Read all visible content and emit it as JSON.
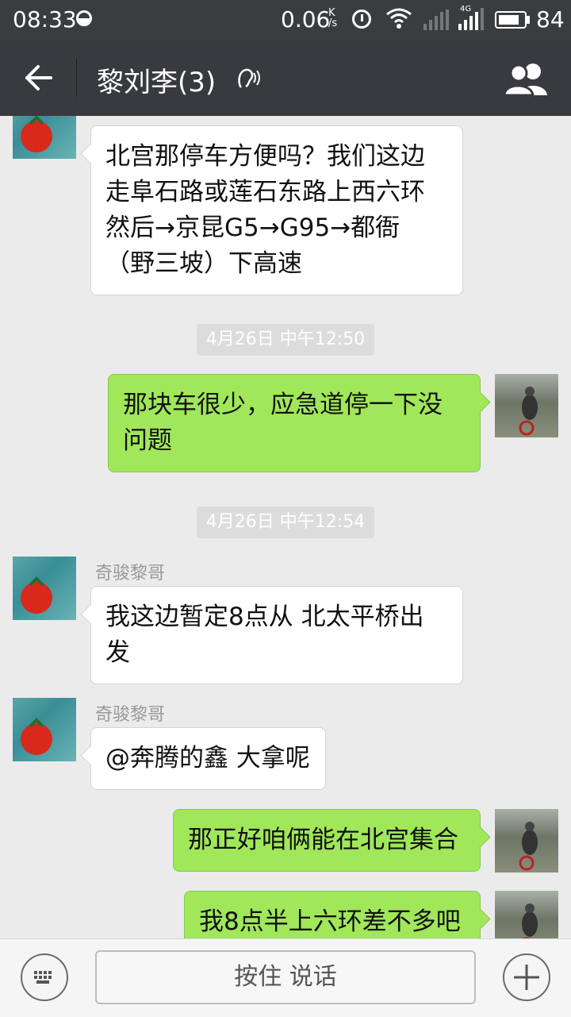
{
  "status_bar": {
    "time": "08:33",
    "net_speed": "0.06",
    "net_speed_unit_top": "K",
    "net_speed_unit_bottom": "/s",
    "network_type": "4G",
    "battery": "84",
    "battery_fraction": 0.84
  },
  "header": {
    "title": "黎刘李(3)",
    "back_icon": "arrow-left-icon",
    "earpiece_icon": "earpiece-mode-icon",
    "group_icon": "group-members-icon"
  },
  "messages": [
    {
      "side": "left",
      "sender": "",
      "text": "北宫那停车方便吗？我们这边走阜石路或莲石东路上西六环然后→京昆G5→G95→都衙（野三坡）下高速"
    },
    {
      "type": "timestamp",
      "text": "4月26日 中午12:50"
    },
    {
      "side": "right",
      "text": "那块车很少，应急道停一下没问题"
    },
    {
      "type": "timestamp",
      "text": "4月26日 中午12:54"
    },
    {
      "side": "left",
      "sender": "奇骏黎哥",
      "text": "我这边暂定8点从 北太平桥出发"
    },
    {
      "side": "left",
      "sender": "奇骏黎哥",
      "text": "@奔腾的鑫 大拿呢"
    },
    {
      "side": "right",
      "text": "那正好咱俩能在北宫集合"
    },
    {
      "side": "right",
      "text": "我8点半上六环差不多吧"
    }
  ],
  "input_bar": {
    "keyboard_icon": "keyboard-icon",
    "hold_to_talk": "按住 说话",
    "plus_icon": "plus-icon"
  },
  "colors": {
    "header_bg": "#393a3f",
    "chat_bg": "#ebebeb",
    "bubble_self": "#a0e75a",
    "bubble_other": "#ffffff"
  }
}
